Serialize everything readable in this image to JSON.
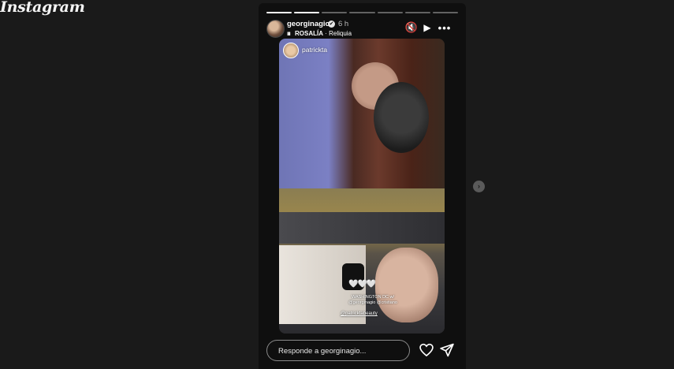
{
  "app": {
    "logo_text": "Instagram"
  },
  "story": {
    "progress": [
      1,
      1,
      0,
      0,
      0,
      0,
      0
    ],
    "username": "georginagio",
    "verified_glyph": "✔",
    "time": "6 h",
    "music_icon": "ııı",
    "music_artist": "ROSALÍA",
    "music_separator": " · ",
    "music_title": "Reliquia",
    "icons": {
      "mute": "mute-icon",
      "play": "play-icon",
      "more": "more-icon"
    },
    "mute_glyph": "🔇",
    "play_glyph": "▶",
    "more_glyph": "•••",
    "shared_from": "patrickta",
    "hearts": "🤍🤍🤍",
    "caption_line1": "WASHINGTON DC w/",
    "caption_line2": "@georginagio @cristiano",
    "caption_mention": "@patricktabeauty"
  },
  "reply": {
    "placeholder": "Responde a georginagio..."
  },
  "actions": {
    "like_glyph": "♡",
    "next_glyph": "›"
  },
  "colors": {
    "background": "#1a1a1a",
    "panel": "#0f0f0f",
    "text": "#ffffff"
  }
}
